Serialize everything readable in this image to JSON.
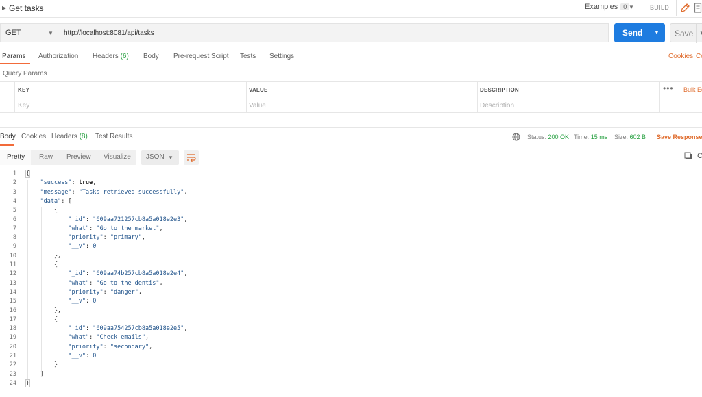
{
  "request": {
    "title": "Get tasks",
    "examples_label": "Examples",
    "examples_count": "0",
    "build_label": "BUILD"
  },
  "url_bar": {
    "method": "GET",
    "url": "http://localhost:8081/api/tasks",
    "send_label": "Send",
    "save_label": "Save"
  },
  "request_tabs": [
    {
      "label": "Params",
      "active": true
    },
    {
      "label": "Authorization"
    },
    {
      "label": "Headers",
      "count": "(6)"
    },
    {
      "label": "Body"
    },
    {
      "label": "Pre-request Script"
    },
    {
      "label": "Tests"
    },
    {
      "label": "Settings"
    }
  ],
  "request_links": {
    "cookies": "Cookies",
    "code": "Co"
  },
  "query_params": {
    "title": "Query Params",
    "columns": [
      "KEY",
      "VALUE",
      "DESCRIPTION"
    ],
    "placeholders": [
      "Key",
      "Value",
      "Description"
    ],
    "bulk_edit": "Bulk Ed"
  },
  "response_tabs": [
    {
      "label": "Body",
      "active": true
    },
    {
      "label": "Cookies"
    },
    {
      "label": "Headers",
      "count": "(8)"
    },
    {
      "label": "Test Results"
    }
  ],
  "response_meta": {
    "status_label": "Status:",
    "status_value": "200 OK",
    "time_label": "Time:",
    "time_value": "15 ms",
    "size_label": "Size:",
    "size_value": "602 B",
    "save_response": "Save Response"
  },
  "format_options": [
    "Pretty",
    "Raw",
    "Preview",
    "Visualize"
  ],
  "language": "JSON",
  "copy_partial": "C",
  "code_lines": [
    "{",
    "    \"success\": true,",
    "    \"message\": \"Tasks retrieved successfully\",",
    "    \"data\": [",
    "        {",
    "            \"_id\": \"609aa721257cb8a5a018e2e3\",",
    "            \"what\": \"Go to the market\",",
    "            \"priority\": \"primary\",",
    "            \"__v\": 0",
    "        },",
    "        {",
    "            \"_id\": \"609aa74b257cb8a5a018e2e4\",",
    "            \"what\": \"Go to the dentis\",",
    "            \"priority\": \"danger\",",
    "            \"__v\": 0",
    "        },",
    "        {",
    "            \"_id\": \"609aa754257cb8a5a018e2e5\",",
    "            \"what\": \"Check emails\",",
    "            \"priority\": \"secondary\",",
    "            \"__v\": 0",
    "        }",
    "    ]",
    "}"
  ],
  "colors": {
    "accent": "#f26b3a",
    "send": "#1e7ce0",
    "status_ok": "#26a040",
    "link": "#e06e30"
  }
}
